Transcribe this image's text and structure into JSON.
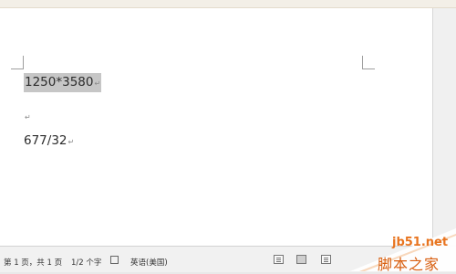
{
  "document": {
    "lines": [
      {
        "text": "1250*3580",
        "selected": true
      },
      {
        "text": ""
      },
      {
        "text": "677/32"
      }
    ],
    "paragraph_mark": "↵"
  },
  "statusbar": {
    "pages": "第 1 页，共 1 页",
    "words": "1/2 个字",
    "language": "英语(美国)"
  },
  "watermark": {
    "url": "jb51.net",
    "name": "脚本之家"
  },
  "colors": {
    "selection": "#c6c6c6",
    "watermark_orange": "#e8741f"
  }
}
